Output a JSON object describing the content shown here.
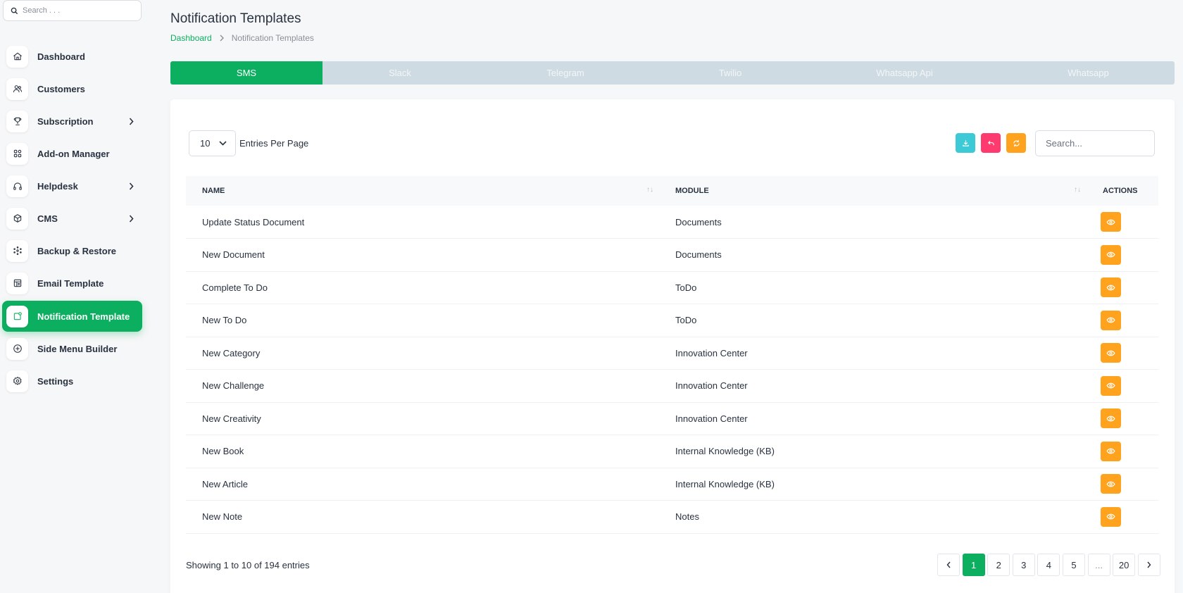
{
  "sidebar": {
    "search_placeholder": "Search . . .",
    "items": [
      {
        "label": "Dashboard",
        "icon": "home-icon",
        "has_children": false,
        "active": false
      },
      {
        "label": "Customers",
        "icon": "users-icon",
        "has_children": false,
        "active": false
      },
      {
        "label": "Subscription",
        "icon": "trophy-icon",
        "has_children": true,
        "active": false
      },
      {
        "label": "Add-on Manager",
        "icon": "grid-icon",
        "has_children": false,
        "active": false
      },
      {
        "label": "Helpdesk",
        "icon": "headphones-icon",
        "has_children": true,
        "active": false
      },
      {
        "label": "CMS",
        "icon": "package-icon",
        "has_children": true,
        "active": false
      },
      {
        "label": "Backup & Restore",
        "icon": "backup-icon",
        "has_children": false,
        "active": false
      },
      {
        "label": "Email Template",
        "icon": "template-icon",
        "has_children": false,
        "active": false
      },
      {
        "label": "Notification Template",
        "icon": "notification-icon",
        "has_children": false,
        "active": true
      },
      {
        "label": "Side Menu Builder",
        "icon": "circle-plus-icon",
        "has_children": false,
        "active": false
      },
      {
        "label": "Settings",
        "icon": "gear-icon",
        "has_children": false,
        "active": false
      }
    ]
  },
  "header": {
    "title": "Notification Templates",
    "breadcrumb": {
      "home": "Dashboard",
      "current": "Notification Templates"
    }
  },
  "tabs": [
    "SMS",
    "Slack",
    "Telegram",
    "Twilio",
    "Whatsapp Api",
    "Whatsapp"
  ],
  "active_tab": 0,
  "table": {
    "entries_value": "10",
    "entries_label": "Entries Per Page",
    "search_placeholder": "Search...",
    "columns": [
      "Name",
      "Module",
      "Actions"
    ],
    "rows": [
      {
        "name": "Update Status Document",
        "module": "Documents"
      },
      {
        "name": "New Document",
        "module": "Documents"
      },
      {
        "name": "Complete To Do",
        "module": "ToDo"
      },
      {
        "name": "New To Do",
        "module": "ToDo"
      },
      {
        "name": "New Category",
        "module": "Innovation Center"
      },
      {
        "name": "New Challenge",
        "module": "Innovation Center"
      },
      {
        "name": "New Creativity",
        "module": "Innovation Center"
      },
      {
        "name": "New Book",
        "module": "Internal Knowledge (KB)"
      },
      {
        "name": "New Article",
        "module": "Internal Knowledge (KB)"
      },
      {
        "name": "New Note",
        "module": "Notes"
      }
    ],
    "showing": "Showing 1 to 10 of 194 entries"
  },
  "pagination": {
    "pages": [
      "1",
      "2",
      "3",
      "4",
      "5",
      "...",
      "20"
    ],
    "active": "1"
  },
  "colors": {
    "primary": "#0caf60",
    "info": "#3ec9d6",
    "danger": "#ff3a6e",
    "warning": "#ffa21d",
    "tab_bg": "#cfdbe2"
  }
}
